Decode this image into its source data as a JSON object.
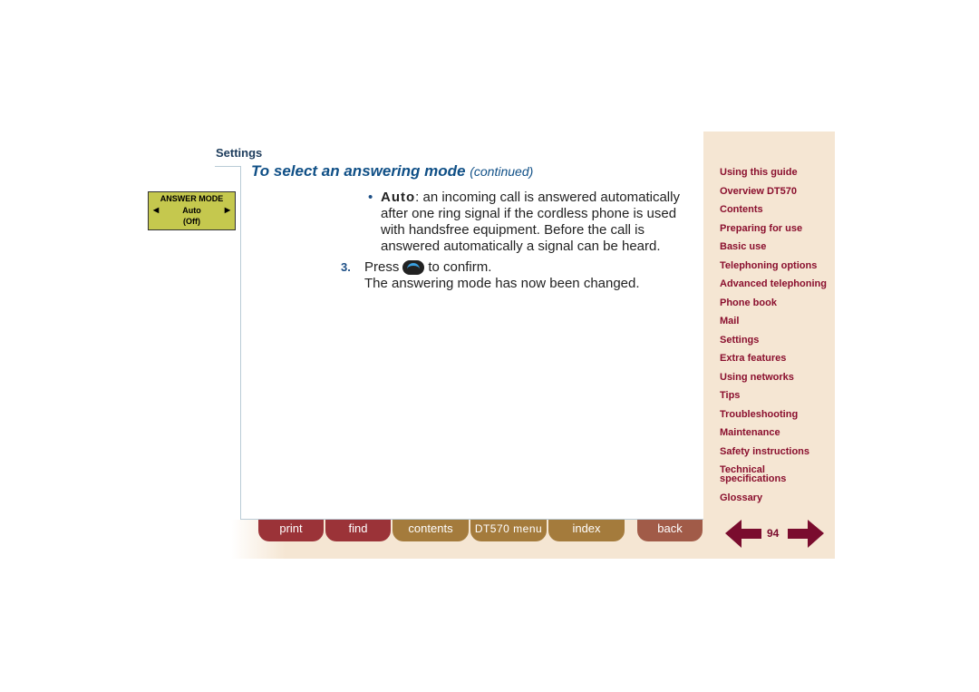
{
  "section": "Settings",
  "title": "To select an answering mode",
  "title_suffix": "(continued)",
  "lcd": {
    "title": "ANSWER MODE",
    "value": "Auto",
    "alt": "(Off)"
  },
  "bullet": {
    "term": "Auto",
    "text": ": an incoming call is answered automatically after one ring signal if the cordless phone is used with handsfree equipment. Before the call is answered automatically a signal can be heard."
  },
  "step": {
    "number": "3.",
    "before": "Press",
    "key": "YES",
    "after": "to confirm.",
    "result": "The answering mode has now been changed."
  },
  "nav": [
    "Using this guide",
    "Overview DT570",
    "Contents",
    "Preparing for use",
    "Basic use",
    "Telephoning options",
    "Advanced telephoning",
    "Phone book",
    "Mail",
    "Settings",
    "Extra features",
    "Using networks",
    "Tips",
    "Troubleshooting",
    "Maintenance",
    "Safety instructions",
    "Technical specifications",
    "Glossary"
  ],
  "buttons": {
    "print": "print",
    "find": "find",
    "contents": "contents",
    "menu": "DT570 menu",
    "index": "index",
    "back": "back"
  },
  "page": "94",
  "colors": {
    "nav": "#8a0f2e",
    "panel": "#f5e6d3",
    "title": "#0f4f86"
  }
}
